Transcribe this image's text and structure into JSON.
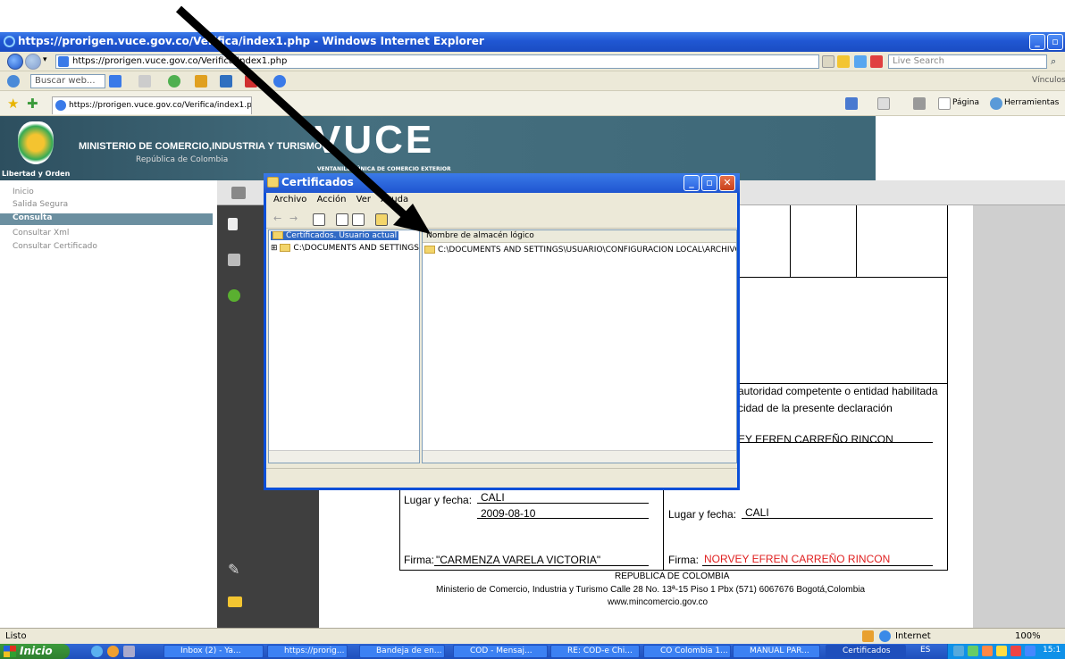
{
  "window": {
    "title": "https://prorigen.vuce.gov.co/Verifica/index1.php - Windows Internet Explorer"
  },
  "address": {
    "url": "https://prorigen.vuce.gov.co/Verifica/index1.php",
    "search_placeholder": "Live Search"
  },
  "searchbar": {
    "placeholder": "Buscar web...",
    "links": "Vínculos"
  },
  "favbar": {
    "tab": "https://prorigen.vuce.gov.co/Verifica/index1.php",
    "pagina": "Página",
    "herramientas": "Herramientas"
  },
  "banner": {
    "ministry": "MINISTERIO DE COMERCIO,INDUSTRIA Y TURISMO",
    "republic": "República de Colombia",
    "motto": "Libertad y Orden",
    "logo": "VUCE",
    "logo_sub": "VENTANILLA ÚNICA DE COMERCIO EXTERIOR"
  },
  "nav": {
    "items": [
      "Inicio",
      "Salida Segura",
      "Consulta",
      "Consultar Xml",
      "Consultar Certificado"
    ]
  },
  "doc": {
    "authority": "autoridad competente o entidad habilitada",
    "veracity": "cidad de la presente declaración",
    "name_partial": "EY EFREN CARREÑO RINCON",
    "place_label": "Lugar y fecha:",
    "place_value": "CALI",
    "date_value": "2009-08-10",
    "firma_label": "Firma:",
    "firma_left": "\"CARMENZA  VARELA VICTORIA\"",
    "firma_right": "NORVEY EFREN CARREÑO RINCON",
    "footer1": "REPUBLICA DE COLOMBIA",
    "footer2": "Ministerio de Comercio, Industria y Turismo Calle 28 No. 13ª-15 Piso 1 Pbx (571) 6067676  Bogotá,Colombia",
    "footer3": "www.mincomercio.gov.co"
  },
  "dialog": {
    "title": "Certificados",
    "menu": [
      "Archivo",
      "Acción",
      "Ver",
      "Ayuda"
    ],
    "tree_root": "Certificados. Usuario actual",
    "tree_child": "C:\\DOCUMENTS AND SETTINGS\\",
    "list_header": "Nombre de almacén lógico",
    "list_item": "C:\\DOCUMENTS AND SETTINGS\\USUARIO\\CONFIGURACIÓN LOCAL\\ARCHIVOS TEMI"
  },
  "status": {
    "left": "Listo",
    "zone": "Internet",
    "zoom": "100%"
  },
  "taskbar": {
    "start": "Inicio",
    "tasks": [
      "Inbox (2) - Ya...",
      "https://prorig...",
      "Bandeja de en...",
      "COD - Mensaj...",
      "RE: COD-e Chi...",
      "CO Colombia 1...",
      "MANUAL PAR...",
      "Certificados"
    ],
    "lang": "ES",
    "clock": "15:1"
  },
  "colors": {
    "xp_blue": "#2057d3",
    "banner": "#456f7f",
    "nav_active": "#6b8fa0",
    "arrow": "#000000",
    "red_text": "#e02020"
  }
}
